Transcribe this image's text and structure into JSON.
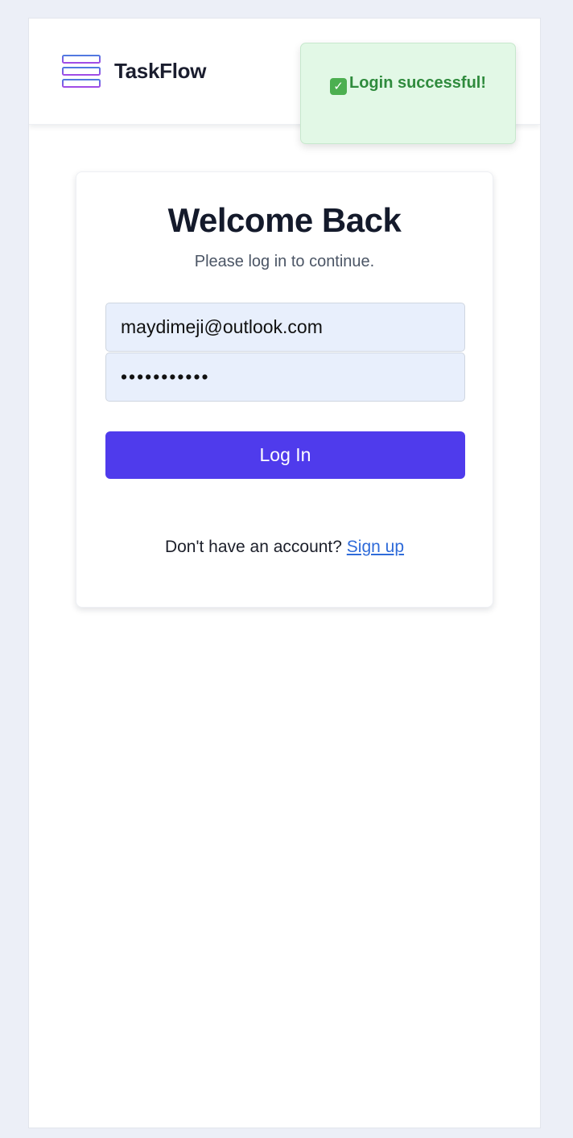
{
  "header": {
    "brand": "TaskFlow",
    "logo_icon": "kanban-stack-icon"
  },
  "toast": {
    "icon": "check-mark-icon",
    "icon_glyph": "✓",
    "message": "Login successful!",
    "color": "#2f8b3d",
    "background": "#e2f8e6"
  },
  "login": {
    "title": "Welcome Back",
    "subtitle": "Please log in to continue.",
    "email_value": "maydimeji@outlook.com",
    "password_value": "secretpass1",
    "button_label": "Log In",
    "button_color": "#4f3bec",
    "signup_prompt": "Don't have an account?",
    "signup_link": "Sign up"
  }
}
